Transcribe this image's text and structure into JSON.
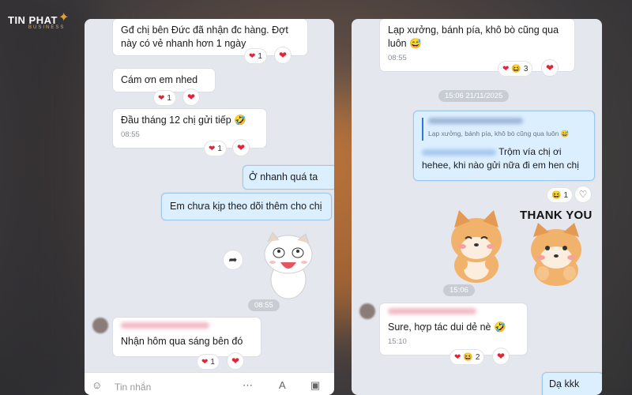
{
  "brand": {
    "name": "TIN PHAT",
    "sub": "BUSINESS"
  },
  "left_chat": {
    "m1": {
      "text": "Gđ chị bên Đức đã nhận đc hàng. Đợt này có vẻ nhanh hơn 1 ngày",
      "count": "1"
    },
    "m2": {
      "text": "Cám ơn em nhed",
      "count": "1"
    },
    "m3": {
      "text": "Đầu tháng 12 chị gửi tiếp 🤣",
      "time": "08:55",
      "count": "1"
    },
    "m4": {
      "text": "Ở nhanh quá ta"
    },
    "m5": {
      "text": "Em chưa kịp theo dõi thêm cho chị"
    },
    "sticker_time": "08:55",
    "m6": {
      "text": "Nhận hôm qua sáng bên đó",
      "count": "1"
    },
    "input_placeholder": "Tin nhắn",
    "icons": {
      "forward": "forward-icon",
      "heart": "heart-icon"
    }
  },
  "right_chat": {
    "m1": {
      "text": "Lạp xưởng, bánh pía, khô bò cũng qua luôn 😅",
      "time": "08:55",
      "count": "3"
    },
    "date_pill": "15:06 21/11/2025",
    "reply": {
      "quote": "Lạp xưởng, bánh pía, khô bò cũng qua luôn 😅",
      "text": "Trộm vía chị ơi hehee, khi nào gửi nữa đi em hen chị",
      "count": "1"
    },
    "sticker_text": "THANK YOU",
    "sticker_time": "15:06",
    "m2": {
      "text": "Sure, hợp tác dui dẻ nè 🤣",
      "time": "15:10",
      "count": "2"
    },
    "m3": {
      "text": "Dạ kkk"
    }
  },
  "colors": {
    "heart": "#e0243b",
    "me_bubble": "#dcefff",
    "accent": "#2f7ad9"
  }
}
